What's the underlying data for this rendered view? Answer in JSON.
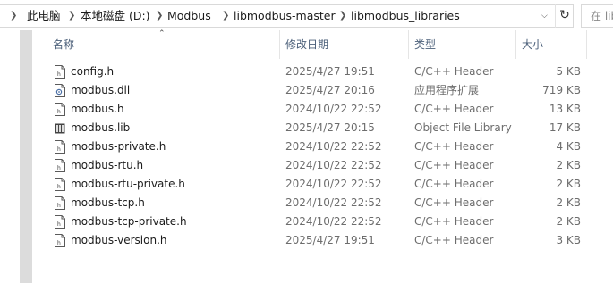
{
  "address": {
    "crumbs": [
      "此电脑",
      "本地磁盘 (D:)",
      "Modbus",
      "libmodbus-master",
      "libmodbus_libraries"
    ],
    "refresh_icon": "refresh-icon",
    "search_placeholder": "在 lib"
  },
  "columns": {
    "name": "名称",
    "date": "修改日期",
    "type": "类型",
    "size": "大小"
  },
  "files": [
    {
      "name": "config.h",
      "date": "2025/4/27 19:51",
      "type": "C/C++ Header",
      "size": "5 KB",
      "icon": "header-file-icon"
    },
    {
      "name": "modbus.dll",
      "date": "2025/4/27 20:16",
      "type": "应用程序扩展",
      "size": "719 KB",
      "icon": "dll-file-icon"
    },
    {
      "name": "modbus.h",
      "date": "2024/10/22 22:52",
      "type": "C/C++ Header",
      "size": "13 KB",
      "icon": "header-file-icon"
    },
    {
      "name": "modbus.lib",
      "date": "2025/4/27 20:15",
      "type": "Object File Library",
      "size": "17 KB",
      "icon": "lib-file-icon"
    },
    {
      "name": "modbus-private.h",
      "date": "2024/10/22 22:52",
      "type": "C/C++ Header",
      "size": "4 KB",
      "icon": "header-file-icon"
    },
    {
      "name": "modbus-rtu.h",
      "date": "2024/10/22 22:52",
      "type": "C/C++ Header",
      "size": "2 KB",
      "icon": "header-file-icon"
    },
    {
      "name": "modbus-rtu-private.h",
      "date": "2024/10/22 22:52",
      "type": "C/C++ Header",
      "size": "2 KB",
      "icon": "header-file-icon"
    },
    {
      "name": "modbus-tcp.h",
      "date": "2024/10/22 22:52",
      "type": "C/C++ Header",
      "size": "2 KB",
      "icon": "header-file-icon"
    },
    {
      "name": "modbus-tcp-private.h",
      "date": "2024/10/22 22:52",
      "type": "C/C++ Header",
      "size": "2 KB",
      "icon": "header-file-icon"
    },
    {
      "name": "modbus-version.h",
      "date": "2025/4/27 19:51",
      "type": "C/C++ Header",
      "size": "3 KB",
      "icon": "header-file-icon"
    }
  ]
}
